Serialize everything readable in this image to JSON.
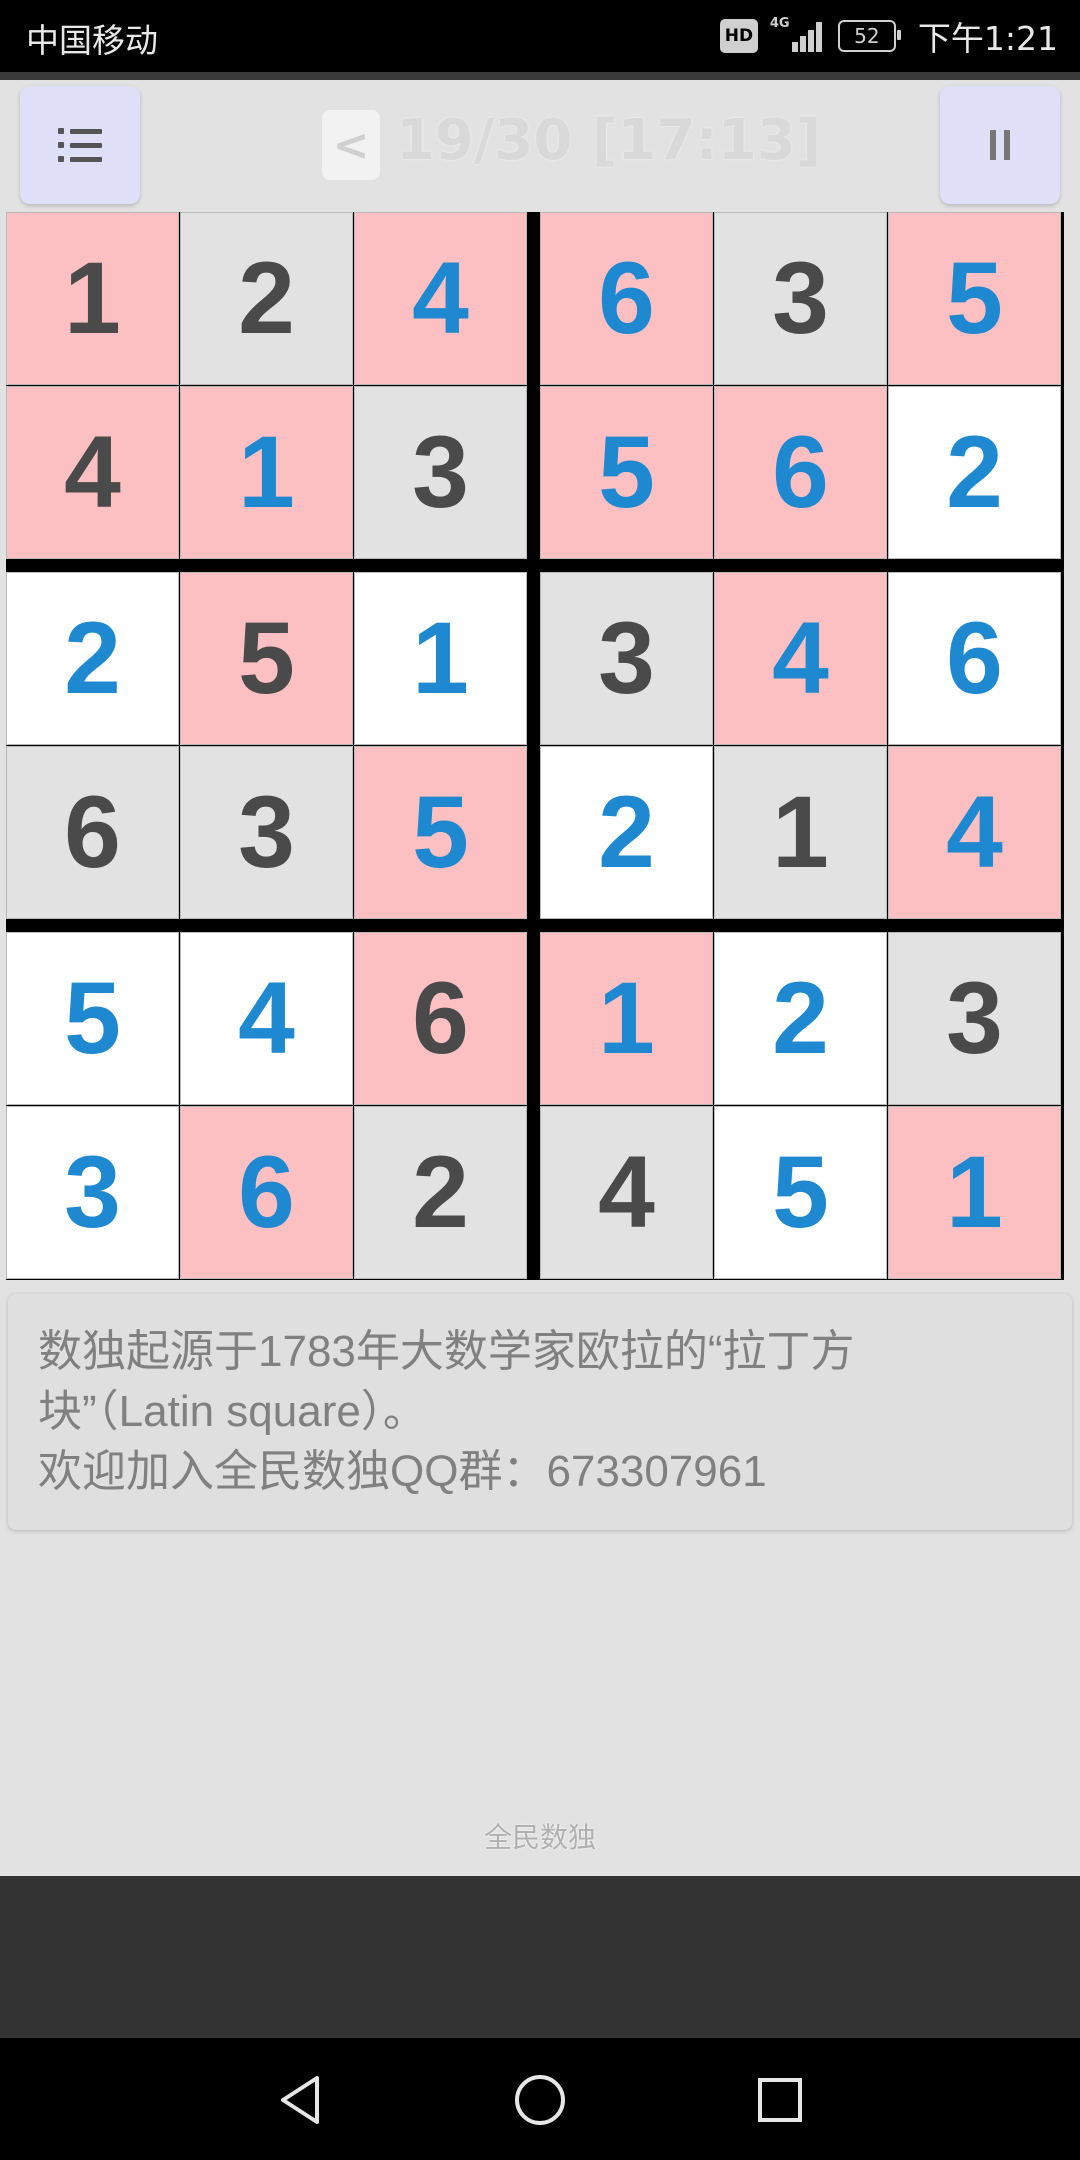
{
  "status_bar": {
    "carrier": "中国移动",
    "hd_badge": "HD",
    "network_type": "4G",
    "battery_level": "52",
    "time": "下午1:21"
  },
  "toolbar": {
    "menu_icon": "list-icon",
    "back_label": "<",
    "level_title": "19/30 [17:13]",
    "pause_icon": "pause-icon"
  },
  "board": {
    "size": 6,
    "digit_colors": {
      "given": "#4a4a4a",
      "entered": "#1e88d0"
    },
    "cell_colors": {
      "pink": "#fcc0c2",
      "gray": "#e2e2e2",
      "white": "#ffffff"
    },
    "rows": [
      [
        {
          "v": "1",
          "bg": "pink",
          "t": "dark"
        },
        {
          "v": "2",
          "bg": "gray",
          "t": "dark"
        },
        {
          "v": "4",
          "bg": "pink",
          "t": "blue"
        },
        {
          "v": "6",
          "bg": "pink",
          "t": "blue"
        },
        {
          "v": "3",
          "bg": "gray",
          "t": "dark"
        },
        {
          "v": "5",
          "bg": "pink",
          "t": "blue"
        }
      ],
      [
        {
          "v": "4",
          "bg": "pink",
          "t": "dark"
        },
        {
          "v": "1",
          "bg": "pink",
          "t": "blue"
        },
        {
          "v": "3",
          "bg": "gray",
          "t": "dark"
        },
        {
          "v": "5",
          "bg": "pink",
          "t": "blue"
        },
        {
          "v": "6",
          "bg": "pink",
          "t": "blue"
        },
        {
          "v": "2",
          "bg": "white",
          "t": "blue"
        }
      ],
      [
        {
          "v": "2",
          "bg": "white",
          "t": "blue"
        },
        {
          "v": "5",
          "bg": "pink",
          "t": "dark"
        },
        {
          "v": "1",
          "bg": "white",
          "t": "blue"
        },
        {
          "v": "3",
          "bg": "gray",
          "t": "dark"
        },
        {
          "v": "4",
          "bg": "pink",
          "t": "blue"
        },
        {
          "v": "6",
          "bg": "white",
          "t": "blue"
        }
      ],
      [
        {
          "v": "6",
          "bg": "gray",
          "t": "dark"
        },
        {
          "v": "3",
          "bg": "gray",
          "t": "dark"
        },
        {
          "v": "5",
          "bg": "pink",
          "t": "blue"
        },
        {
          "v": "2",
          "bg": "white",
          "t": "blue"
        },
        {
          "v": "1",
          "bg": "gray",
          "t": "dark"
        },
        {
          "v": "4",
          "bg": "pink",
          "t": "blue"
        }
      ],
      [
        {
          "v": "5",
          "bg": "white",
          "t": "blue"
        },
        {
          "v": "4",
          "bg": "white",
          "t": "blue"
        },
        {
          "v": "6",
          "bg": "pink",
          "t": "dark"
        },
        {
          "v": "1",
          "bg": "pink",
          "t": "blue"
        },
        {
          "v": "2",
          "bg": "white",
          "t": "blue"
        },
        {
          "v": "3",
          "bg": "gray",
          "t": "dark"
        }
      ],
      [
        {
          "v": "3",
          "bg": "white",
          "t": "blue"
        },
        {
          "v": "6",
          "bg": "pink",
          "t": "blue"
        },
        {
          "v": "2",
          "bg": "gray",
          "t": "dark"
        },
        {
          "v": "4",
          "bg": "gray",
          "t": "dark"
        },
        {
          "v": "5",
          "bg": "white",
          "t": "blue"
        },
        {
          "v": "1",
          "bg": "pink",
          "t": "blue"
        }
      ]
    ]
  },
  "info": {
    "line1": "数独起源于1783年大数学家欧拉的“拉丁方块”（Latin square）。",
    "line2": "欢迎加入全民数独QQ群：673307961"
  },
  "footer": {
    "app_name": "全民数独"
  },
  "nav_bar": {
    "back_icon": "triangle-back-icon",
    "home_icon": "circle-home-icon",
    "recents_icon": "square-recents-icon"
  }
}
